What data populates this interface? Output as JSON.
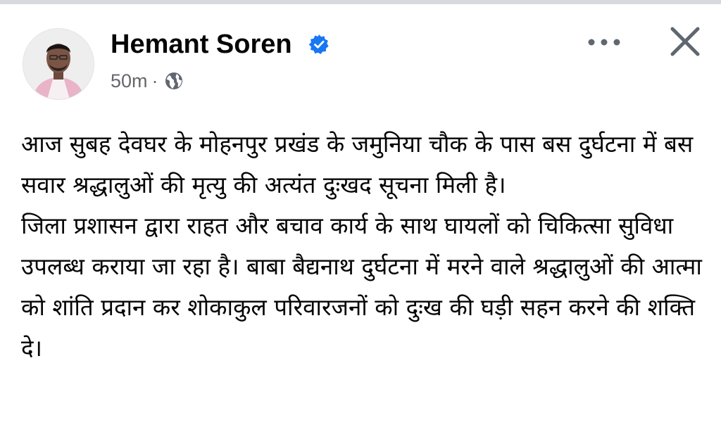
{
  "post": {
    "author_name": "Hemant Soren",
    "verified": true,
    "timestamp": "50m",
    "separator": "·",
    "audience_icon": "globe-icon",
    "more_icon": "more-horizontal-icon",
    "close_icon": "close-icon",
    "paragraphs": [
      "आज सुबह देवघर के मोहनपुर प्रखंड के जमुनिया चौक के पास बस दुर्घटना में बस सवार श्रद्धालुओं की मृत्यु की अत्यंत दुःखद सूचना मिली है।",
      "जिला प्रशासन द्वारा राहत और बचाव कार्य के साथ घायलों को चिकित्सा सुविधा उपलब्ध कराया जा रहा है।  बाबा बैद्यनाथ दुर्घटना में मरने वाले श्रद्धालुओं की आत्मा को शांति प्रदान कर शोकाकुल परिवारजनों को दुःख की घड़ी सहन करने की शक्ति दे।"
    ]
  },
  "colors": {
    "verified_badge": "#1877f2",
    "meta_text": "#65676b",
    "body_text": "#050505",
    "icon": "#606770"
  }
}
